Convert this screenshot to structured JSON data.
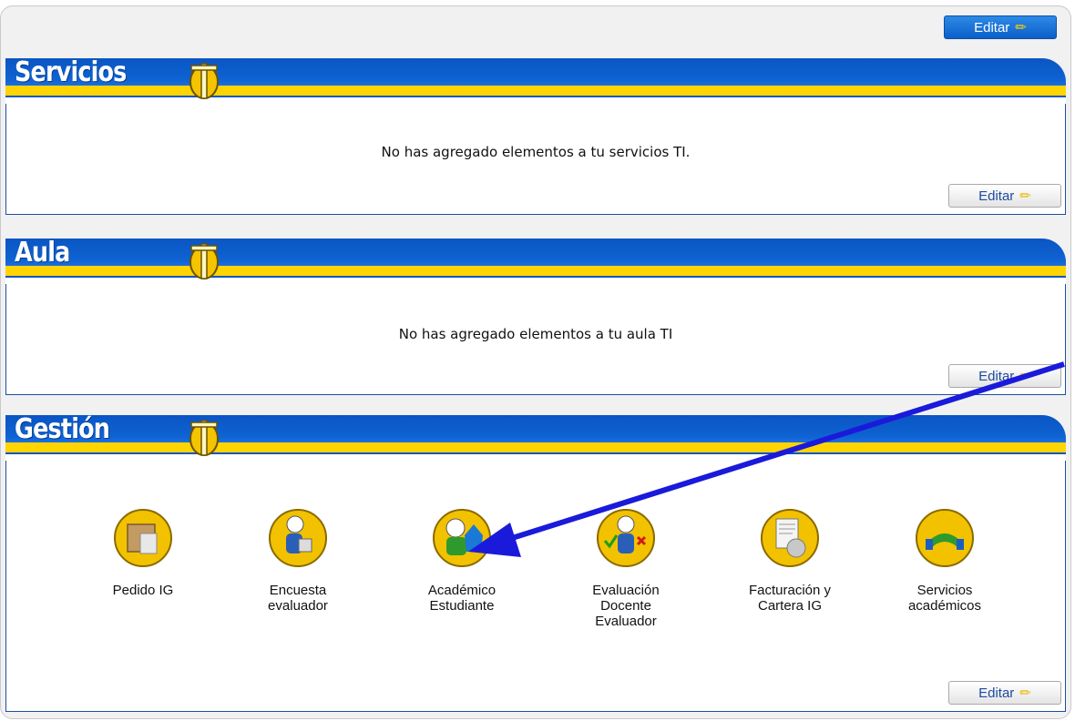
{
  "top_edit_label": "Editar",
  "sections": {
    "servicios": {
      "title": "Servicios",
      "empty_message": "No has agregado elementos a tu servicios TI.",
      "edit_label": "Editar"
    },
    "aula": {
      "title": "Aula",
      "empty_message": "No has agregado elementos a tu aula TI",
      "edit_label": "Editar"
    },
    "gestion": {
      "title": "Gestión",
      "edit_label": "Editar",
      "items": [
        {
          "label": "Pedido IG",
          "icon": "package-icon"
        },
        {
          "label": "Encuesta\nevaluador",
          "icon": "survey-evaluator-icon"
        },
        {
          "label": "Académico\nEstudiante",
          "icon": "student-academic-icon"
        },
        {
          "label": "Evaluación\nDocente\nEvaluador",
          "icon": "teacher-evaluation-icon"
        },
        {
          "label": "Facturación y\nCartera IG",
          "icon": "billing-document-icon"
        },
        {
          "label": "Servicios\nacadémicos",
          "icon": "academic-services-icon"
        }
      ]
    }
  },
  "colors": {
    "band_blue": "#0a55c4",
    "band_yellow": "#ffd400",
    "arrow_blue": "#1a1adb"
  }
}
